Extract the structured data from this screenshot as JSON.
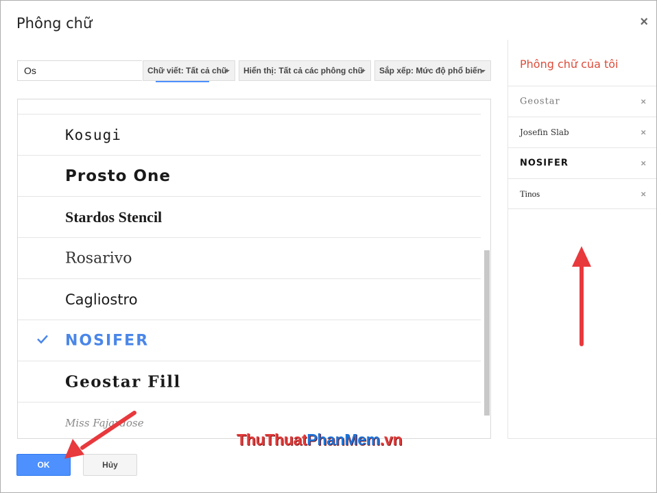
{
  "dialog": {
    "title": "Phông chữ",
    "close_label": "×"
  },
  "search": {
    "value": "Os"
  },
  "filters": {
    "script": "Chữ viết: Tất cả chữ",
    "show": "Hiển thị: Tất cả các phông chữ",
    "sort": "Sắp xếp: Mức độ phổ biến"
  },
  "font_list": [
    {
      "name": "Kosugi",
      "selected": false
    },
    {
      "name": "Prosto One",
      "selected": false
    },
    {
      "name": "Stardos Stencil",
      "selected": false
    },
    {
      "name": "Rosarivo",
      "selected": false
    },
    {
      "name": "Cagliostro",
      "selected": false
    },
    {
      "name": "NOSIFER",
      "selected": true
    },
    {
      "name": "Geostar Fill",
      "selected": false
    },
    {
      "name": "Miss Fajardose",
      "selected": false
    }
  ],
  "my_fonts": {
    "heading": "Phông chữ của tôi",
    "items": [
      {
        "name": "Geostar",
        "remove": "×"
      },
      {
        "name": "Josefin Slab",
        "remove": "×"
      },
      {
        "name": "NOSIFER",
        "remove": "×"
      },
      {
        "name": "Tinos",
        "remove": "×"
      }
    ]
  },
  "buttons": {
    "ok": "OK",
    "cancel": "Hủy"
  },
  "watermark": {
    "part1": "ThuThuat",
    "part2": "PhanMem",
    "part3": ".vn"
  },
  "colors": {
    "accent": "#4d90fe",
    "heading_red": "#dd4b39",
    "arrow_red": "#e8393d",
    "check_blue": "#4a86e8"
  },
  "icons": {
    "check": "check-icon",
    "remove": "close-icon",
    "dropdown": "caret-down-icon"
  }
}
